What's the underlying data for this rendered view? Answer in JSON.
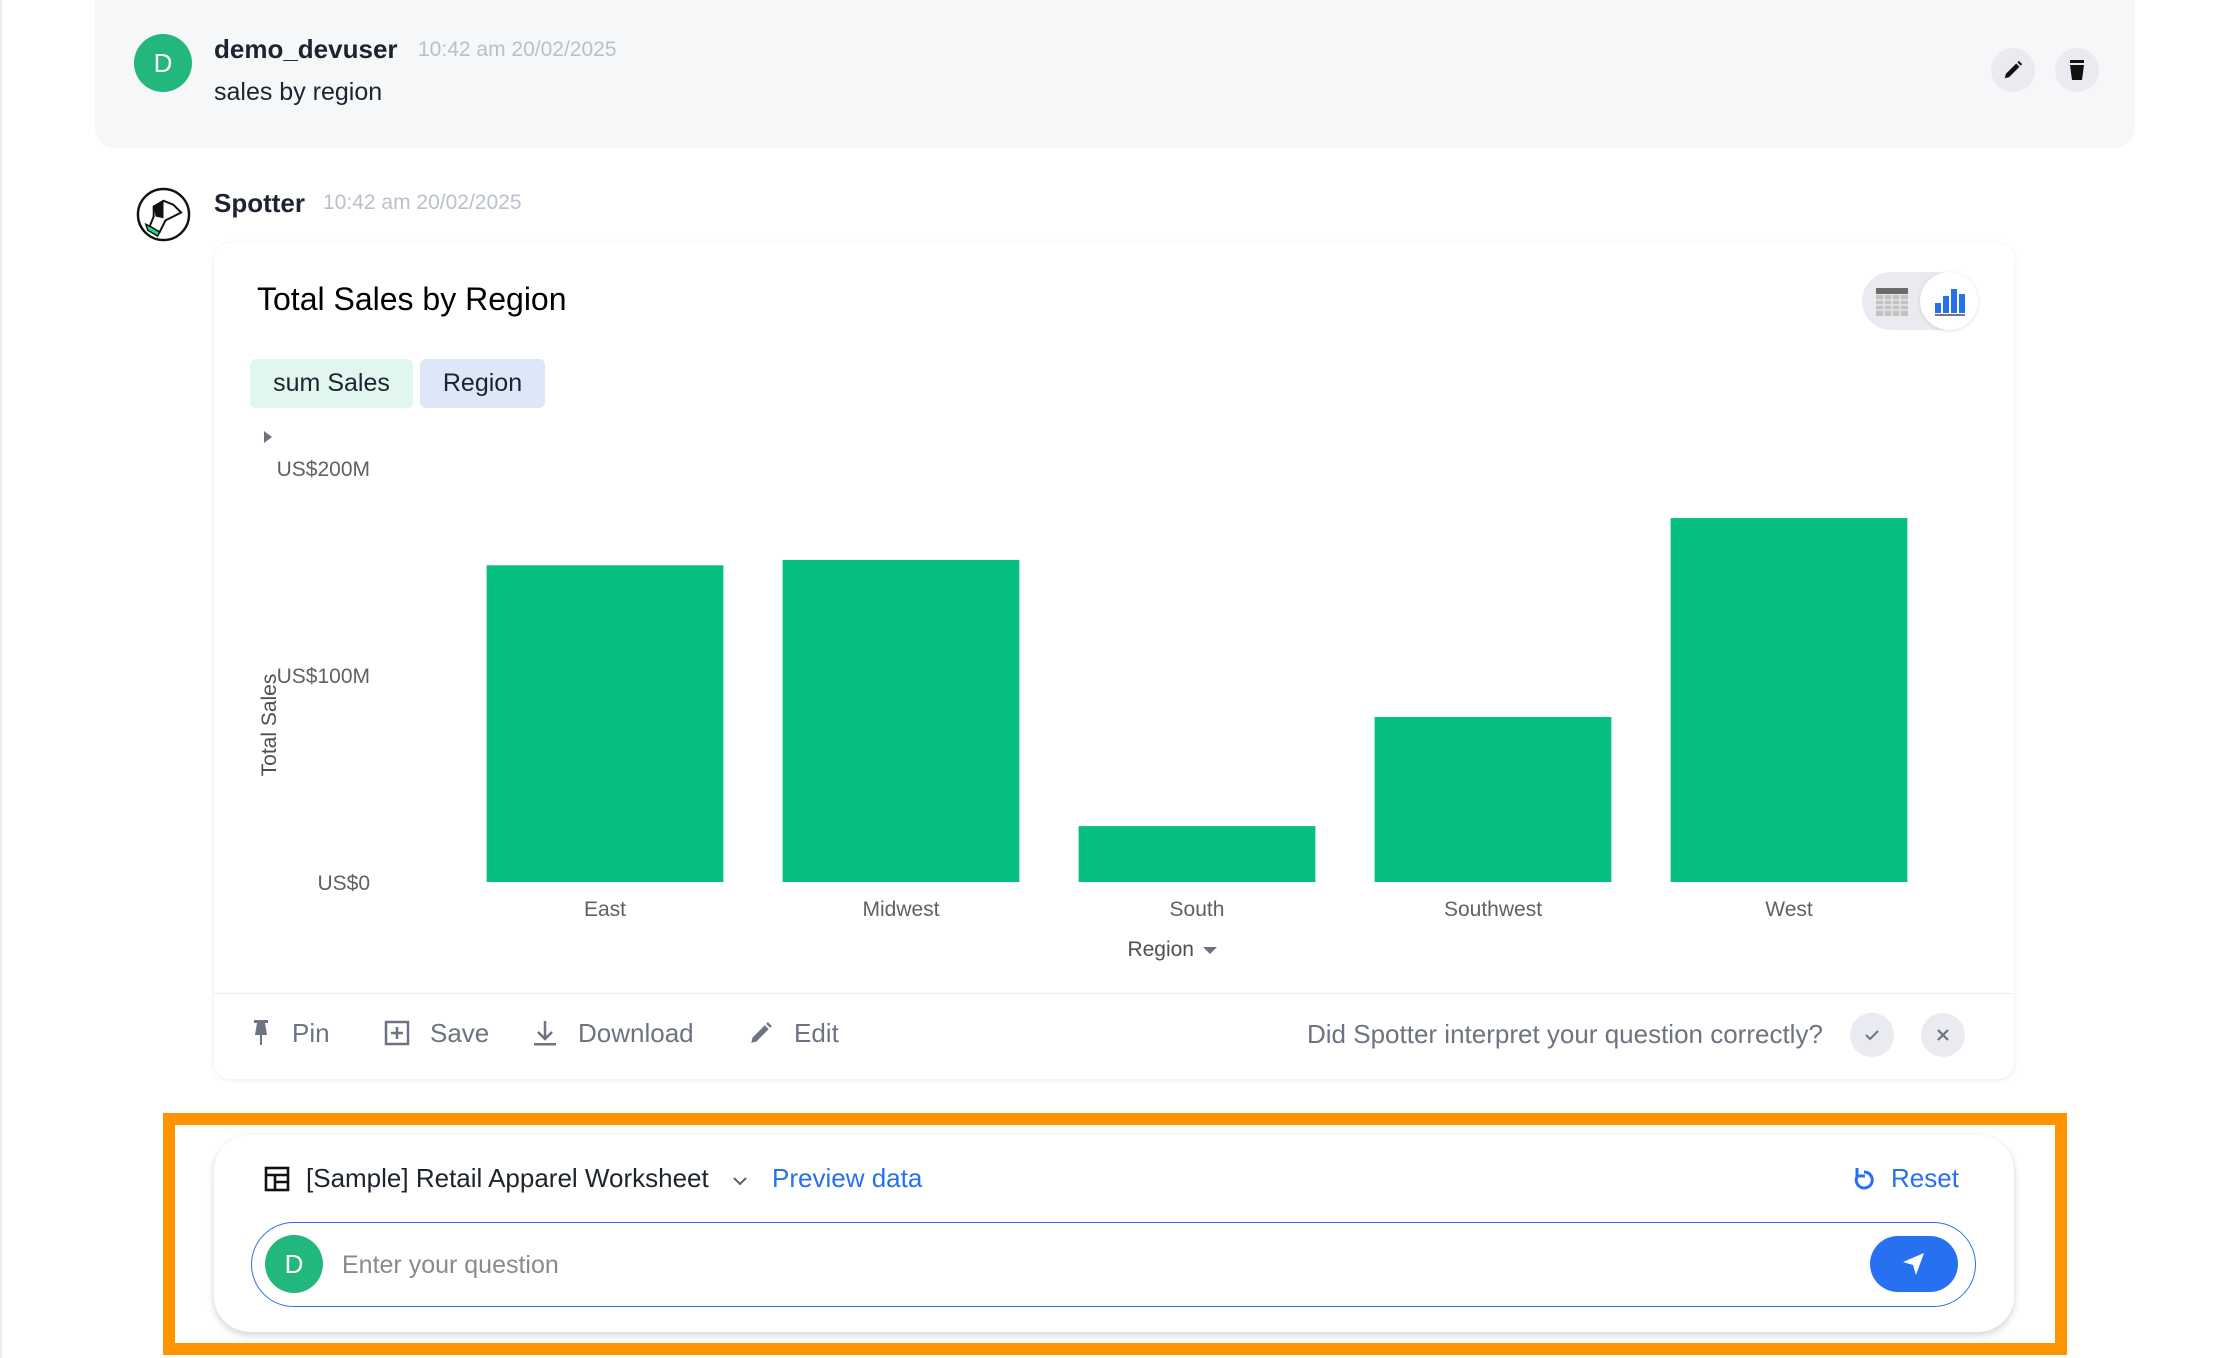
{
  "user_message": {
    "avatar_initial": "D",
    "username": "demo_devuser",
    "timestamp": "10:42 am 20/02/2025",
    "text": "sales by region",
    "actions": {
      "edit_icon": "pencil-icon",
      "delete_icon": "trash-icon"
    }
  },
  "spotter_message": {
    "name": "Spotter",
    "timestamp": "10:42 am 20/02/2025",
    "logo_icon": "spotter-dog-icon"
  },
  "answer": {
    "title": "Total Sales by Region",
    "chips": [
      {
        "label": "sum Sales",
        "kind": "measure"
      },
      {
        "label": "Region",
        "kind": "attribute"
      }
    ],
    "view_toggle": {
      "options": [
        "table",
        "chart"
      ],
      "selected": "chart"
    },
    "actions": [
      {
        "label": "Pin",
        "icon": "pin-icon"
      },
      {
        "label": "Save",
        "icon": "save-plus-icon"
      },
      {
        "label": "Download",
        "icon": "download-icon"
      },
      {
        "label": "Edit",
        "icon": "pencil-icon"
      }
    ],
    "feedback_question": "Did Spotter interpret your question correctly?",
    "feedback_icons": {
      "yes": "check-icon",
      "no": "close-icon"
    }
  },
  "chart_data": {
    "type": "bar",
    "title": "Total Sales by Region",
    "categories": [
      "East",
      "Midwest",
      "South",
      "Southwest",
      "West"
    ],
    "values": [
      153000000,
      155600000,
      27000000,
      79700000,
      175800000
    ],
    "value_unit": "USD",
    "xlabel": "Region",
    "ylabel": "Total Sales",
    "ylim": [
      0,
      200000000
    ],
    "yticks": [
      {
        "value": 0,
        "label": "US$0"
      },
      {
        "value": 100000000,
        "label": "US$100M"
      },
      {
        "value": 200000000,
        "label": "US$200M"
      }
    ],
    "grid": false,
    "legend": "none",
    "bar_color": "#04bf80"
  },
  "composer": {
    "worksheet_name": "[Sample] Retail Apparel Worksheet",
    "preview_label": "Preview data",
    "reset_label": "Reset",
    "avatar_initial": "D",
    "question_placeholder": "Enter your question",
    "question_value": "",
    "highlight_color": "#ff9400",
    "accent_color": "#2770ef"
  }
}
